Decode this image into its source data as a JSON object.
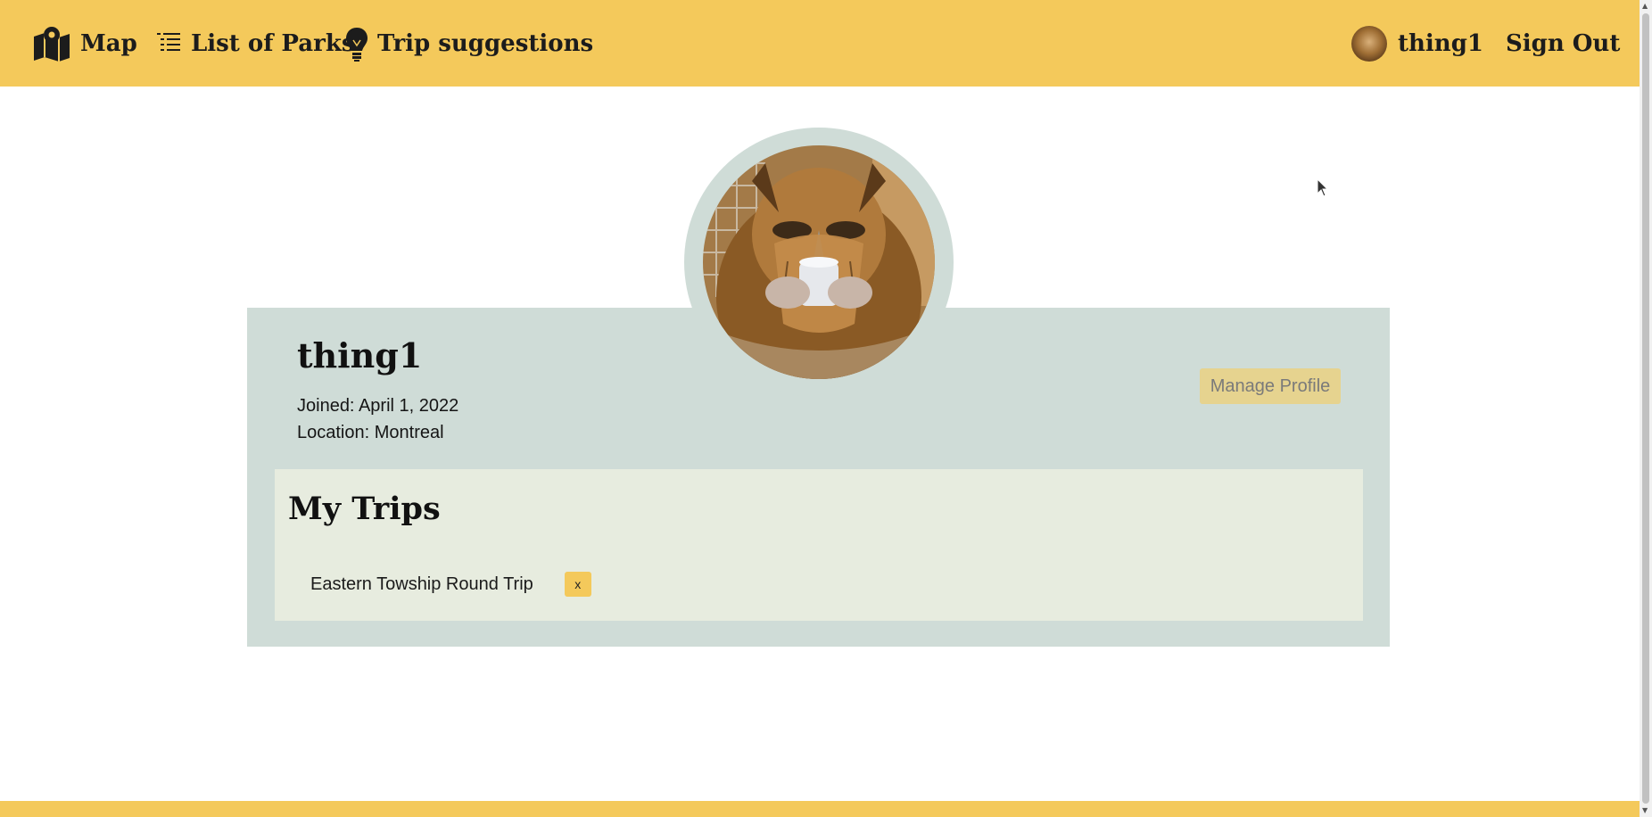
{
  "nav": {
    "map_label": "Map",
    "parks_label": "List of Parks",
    "trips_label": "Trip suggestions",
    "user_label": "thing1",
    "signout_label": "Sign Out"
  },
  "profile": {
    "username": "thing1",
    "joined": "Joined: April 1, 2022",
    "location": "Location: Montreal",
    "manage_label": "Manage Profile",
    "avatar_alt": "Owl holding a cup"
  },
  "trips": {
    "heading": "My Trips",
    "items": [
      {
        "name": "Eastern Towship Round Trip",
        "remove_label": "x"
      }
    ]
  },
  "colors": {
    "accent": "#f4c95b",
    "card": "#cfdcd7",
    "panel": "#e7ecdf"
  },
  "icons": [
    "map-pin-icon",
    "list-icon",
    "lightbulb-icon",
    "avatar"
  ]
}
